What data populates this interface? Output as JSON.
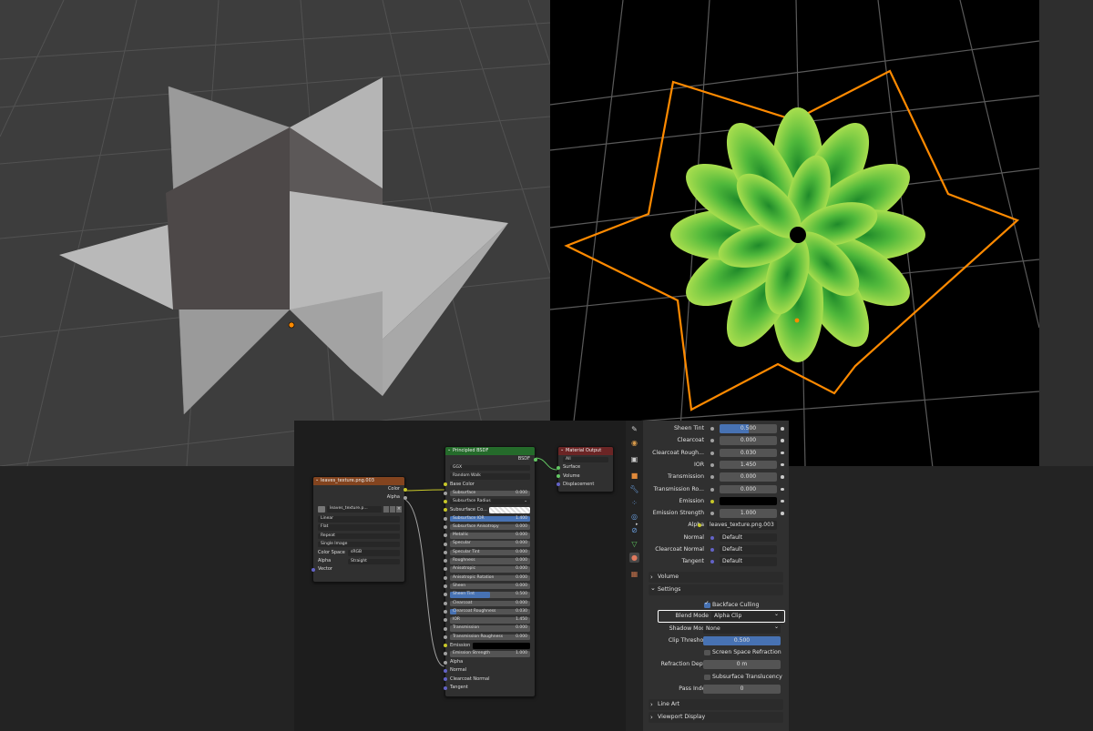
{
  "colors": {
    "accent": "#4772b3",
    "selection": "#ff8a00",
    "socket_color": "#c7c729",
    "socket_float": "#a1a1a1",
    "socket_vector": "#6363c7",
    "socket_shader": "#63c763",
    "foliage_light": "#9fd84a",
    "foliage_dark": "#2e9a30"
  },
  "viewport_left": {
    "scene": "solid-shading planes"
  },
  "viewport_right": {
    "scene": "material preview foliage"
  },
  "node_editor": {
    "image_node": {
      "title": "leaves_texture.png.003",
      "out_color": "Color",
      "out_alpha": "Alpha",
      "image_name": "leaves_texture.p...",
      "interpolation": "Linear",
      "projection": "Flat",
      "extension": "Repeat",
      "source": "Single Image",
      "color_space_label": "Color Space",
      "color_space": "sRGB",
      "alpha_label": "Alpha",
      "alpha_mode": "Straight",
      "vector": "Vector"
    },
    "bsdf_node": {
      "title": "Principled BSDF",
      "out": "BSDF",
      "distribution": "GGX",
      "subsurface_method": "Random Walk",
      "rows": [
        {
          "label": "Base Color",
          "kind": "socket"
        },
        {
          "label": "Subsurface",
          "value": "0.000",
          "kind": "field"
        },
        {
          "label": "Subsurface Radius",
          "kind": "dropdown"
        },
        {
          "label": "Subsurface Co...",
          "kind": "colorfield"
        },
        {
          "label": "Subsurface IOR",
          "value": "1.400",
          "kind": "field",
          "fill": 1
        },
        {
          "label": "Subsurface Anisotropy",
          "value": "0.000",
          "kind": "field"
        },
        {
          "label": "Metallic",
          "value": "0.000",
          "kind": "field"
        },
        {
          "label": "Specular",
          "value": "0.000",
          "kind": "field"
        },
        {
          "label": "Specular Tint",
          "value": "0.000",
          "kind": "field"
        },
        {
          "label": "Roughness",
          "value": "0.000",
          "kind": "field"
        },
        {
          "label": "Anisotropic",
          "value": "0.000",
          "kind": "field"
        },
        {
          "label": "Anisotropic Rotation",
          "value": "0.000",
          "kind": "field"
        },
        {
          "label": "Sheen",
          "value": "0.000",
          "kind": "field"
        },
        {
          "label": "Sheen Tint",
          "value": "0.500",
          "kind": "field",
          "fill": 0.5
        },
        {
          "label": "Clearcoat",
          "value": "0.000",
          "kind": "field"
        },
        {
          "label": "Clearcoat Roughness",
          "value": "0.030",
          "kind": "field",
          "fill": 0.03
        },
        {
          "label": "IOR",
          "value": "1.450",
          "kind": "field"
        },
        {
          "label": "Transmission",
          "value": "0.000",
          "kind": "field"
        },
        {
          "label": "Transmission Roughness",
          "value": "0.000",
          "kind": "field"
        },
        {
          "label": "Emission",
          "kind": "colorblack"
        },
        {
          "label": "Emission Strength",
          "value": "1.000",
          "kind": "field"
        },
        {
          "label": "Alpha",
          "kind": "socket"
        },
        {
          "label": "Normal",
          "kind": "socket"
        },
        {
          "label": "Clearcoat Normal",
          "kind": "socket"
        },
        {
          "label": "Tangent",
          "kind": "socket"
        }
      ]
    },
    "output_node": {
      "title": "Material Output",
      "target": "All",
      "inputs": [
        "Surface",
        "Volume",
        "Displacement"
      ]
    }
  },
  "properties": {
    "rows": [
      {
        "label": "Sheen Tint",
        "value": "0.500",
        "type": "slider",
        "fill": 0.5
      },
      {
        "label": "Clearcoat",
        "value": "0.000",
        "type": "num"
      },
      {
        "label": "Clearcoat Rough...",
        "value": "0.030",
        "type": "num"
      },
      {
        "label": "IOR",
        "value": "1.450",
        "type": "num"
      },
      {
        "label": "Transmission",
        "value": "0.000",
        "type": "num"
      },
      {
        "label": "Transmission Ro...",
        "value": "0.000",
        "type": "num"
      },
      {
        "label": "Emission",
        "value": "",
        "type": "color"
      },
      {
        "label": "Emission Strength",
        "value": "1.000",
        "type": "num"
      },
      {
        "label": "Alpha",
        "value": "leaves_texture.png.003",
        "type": "link"
      },
      {
        "label": "Normal",
        "value": "Default",
        "type": "link"
      },
      {
        "label": "Clearcoat Normal",
        "value": "Default",
        "type": "link"
      },
      {
        "label": "Tangent",
        "value": "Default",
        "type": "link"
      }
    ],
    "volume_section": "Volume",
    "settings_section": "Settings",
    "backface_culling": "Backface Culling",
    "blend_mode_label": "Blend Mode",
    "blend_mode": "Alpha Clip",
    "shadow_mode_label": "Shadow Mode",
    "shadow_mode": "None",
    "clip_threshold_label": "Clip Threshold",
    "clip_threshold": "0.500",
    "screen_space_refraction": "Screen Space Refraction",
    "refraction_depth_label": "Refraction Depth",
    "refraction_depth": "0 m",
    "subsurface_translucency": "Subsurface Translucency",
    "pass_index_label": "Pass Index",
    "pass_index": "0",
    "line_art_section": "Line Art",
    "viewport_display_section": "Viewport Display"
  }
}
